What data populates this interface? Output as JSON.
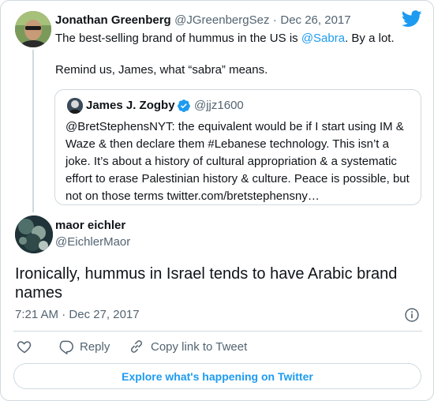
{
  "parent_tweet": {
    "author_name": "Jonathan Greenberg",
    "author_handle": "@JGreenbergSez",
    "separator": "·",
    "date": "Dec 26, 2017",
    "text_before_mention": "The best-selling brand of hummus in the US is ",
    "mention": "@Sabra",
    "text_after_mention": ". By a lot.",
    "text_line2": "Remind us, James, what “sabra” means."
  },
  "quoted_tweet": {
    "author_name": "James J. Zogby",
    "author_handle": "@jjz1600",
    "verified": true,
    "lines": [
      "@BretStephensNYT: the equivalent would be if I start using IM &",
      "Waze & then declare them #Lebanese technology. This isn’t a",
      "joke. It’s about a history of cultural appropriation & a systematic",
      "effort to erase Palestinian history & culture. Peace is possible, but",
      "not on those terms twitter.com/bretstephensny…"
    ]
  },
  "main_tweet": {
    "author_name": "maor eichler",
    "author_handle": "@EichlerMaor",
    "text_line1": "Ironically, hummus in Israel tends to have Arabic brand",
    "text_line2": "names",
    "time": "7:21 AM",
    "separator": "·",
    "date": "Dec 27, 2017"
  },
  "actions": {
    "reply_label": "Reply",
    "copy_label": "Copy link to Tweet"
  },
  "explore_label": "Explore what's happening on Twitter",
  "colors": {
    "accent": "#1d9bf0",
    "text": "#0f1419",
    "muted": "#536471",
    "border": "#cfd9de"
  },
  "icons": [
    "twitter-bird-icon",
    "verified-badge-icon",
    "info-icon",
    "heart-icon",
    "reply-icon",
    "link-icon"
  ]
}
